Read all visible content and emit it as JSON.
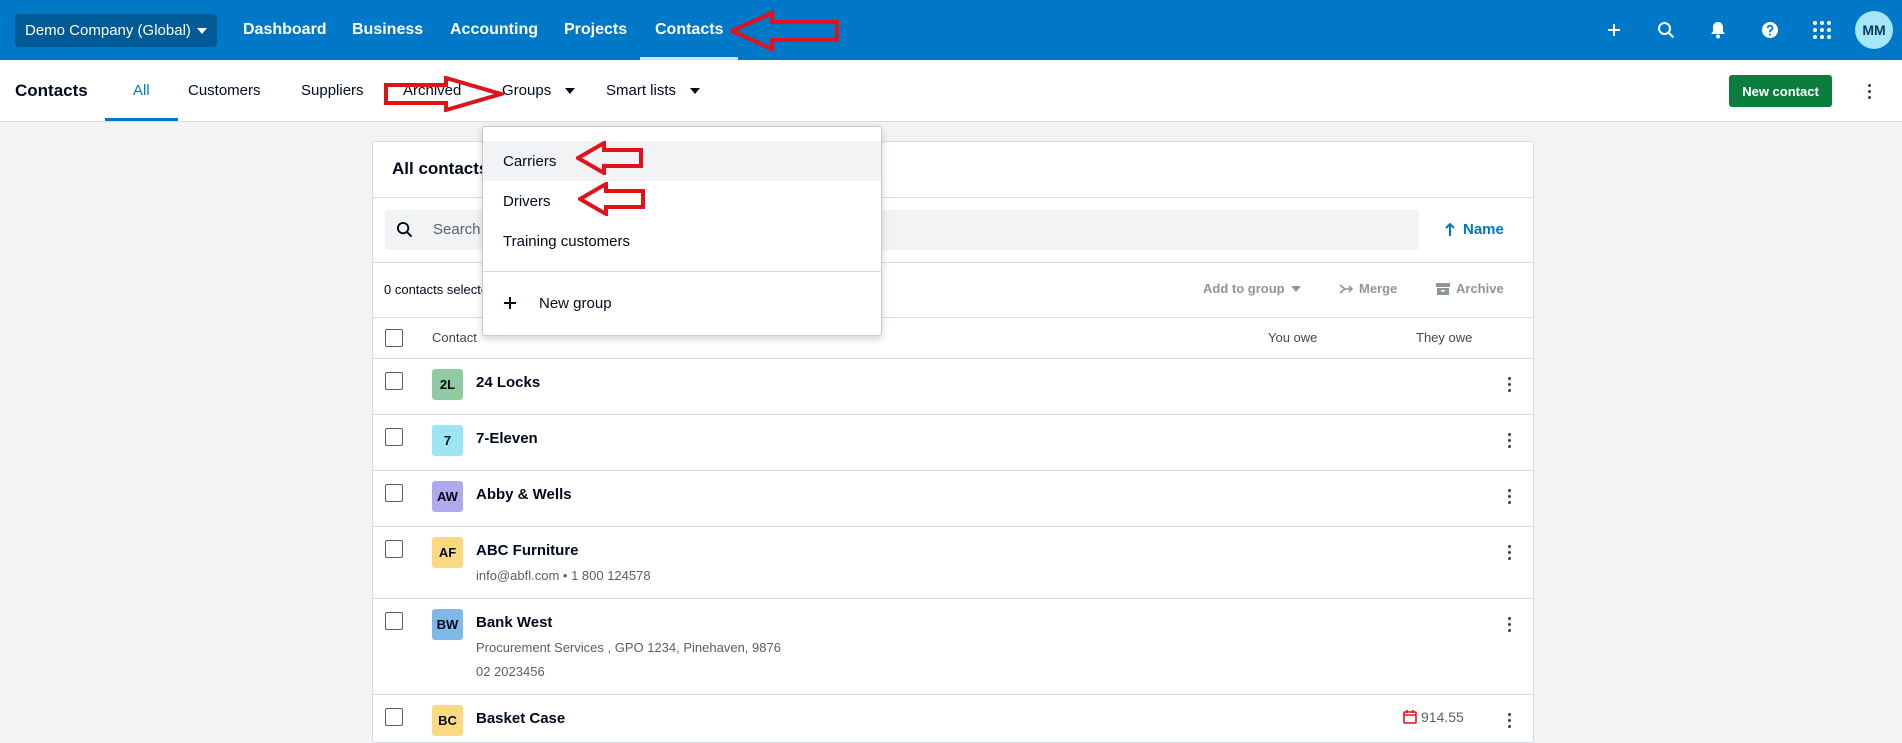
{
  "topbar": {
    "org": "Demo Company (Global)",
    "nav": [
      {
        "label": "Dashboard"
      },
      {
        "label": "Business"
      },
      {
        "label": "Accounting"
      },
      {
        "label": "Projects"
      },
      {
        "label": "Contacts",
        "active": true
      }
    ],
    "avatar": "MM",
    "icons": [
      "plus-icon",
      "search-icon",
      "bell-icon",
      "help-icon",
      "app-grid-icon"
    ]
  },
  "subnav": {
    "title": "Contacts",
    "tabs": [
      {
        "label": "All",
        "active": true
      },
      {
        "label": "Customers"
      },
      {
        "label": "Suppliers"
      },
      {
        "label": "Archived"
      },
      {
        "label": "Groups"
      },
      {
        "label": "Smart lists"
      }
    ],
    "new_contact": "New contact"
  },
  "card": {
    "title": "All contacts",
    "search_placeholder": "Search",
    "sort_label": "Name",
    "selected_count": "0 contacts selected",
    "actions": {
      "add_to_group": "Add to group",
      "merge": "Merge",
      "archive": "Archive"
    },
    "columns": {
      "contact": "Contact",
      "you_owe": "You owe",
      "they_owe": "They owe"
    },
    "rows": [
      {
        "initials": "2L",
        "name": "24 Locks",
        "color": "#8fcaa0"
      },
      {
        "initials": "7",
        "name": "7-Eleven",
        "color": "#9be6f2"
      },
      {
        "initials": "AW",
        "name": "Abby & Wells",
        "color": "#b0a9ec"
      },
      {
        "initials": "AF",
        "name": "ABC Furniture",
        "color": "#fbd980",
        "line1": "info@abfl.com  •  1 800 124578"
      },
      {
        "initials": "BW",
        "name": "Bank West",
        "color": "#7fb8e6",
        "line1": "Procurement Services , GPO 1234, Pinehaven, 9876",
        "line2": "02 2023456"
      },
      {
        "initials": "BC",
        "name": "Basket Case",
        "color": "#fbd980",
        "they_owe": "914.55"
      }
    ]
  },
  "groups_menu": {
    "items": [
      "Carriers",
      "Drivers",
      "Training customers"
    ],
    "new_group": "New group"
  },
  "colors": {
    "brand_blue": "#0078c8",
    "new_contact_green": "#0b7d3e",
    "annotation_red": "#e0121b"
  }
}
